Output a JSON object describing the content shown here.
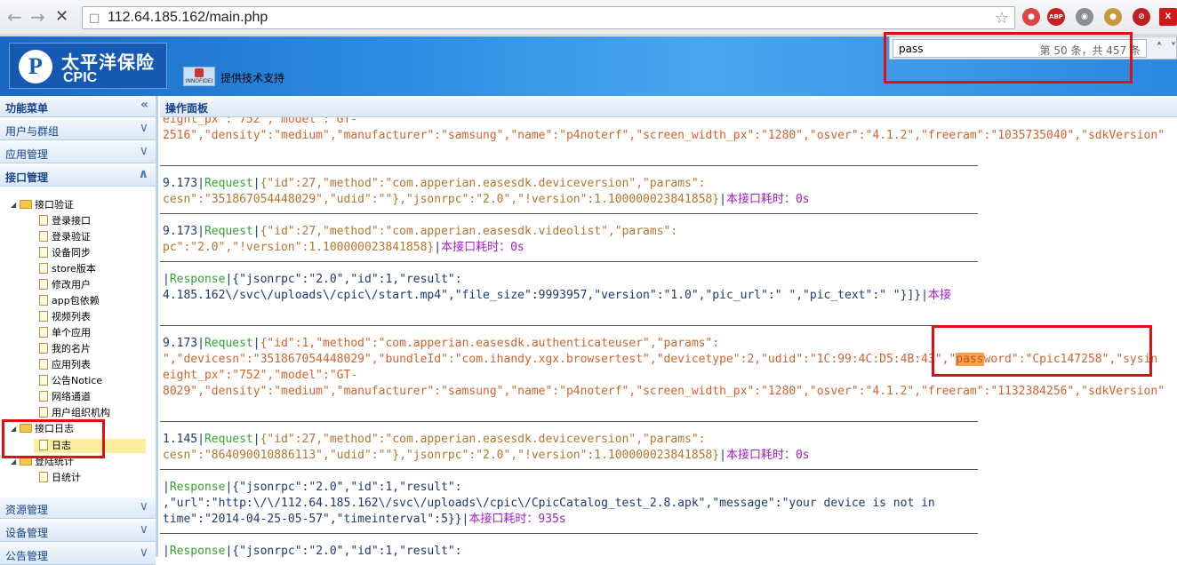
{
  "browser": {
    "url": "112.64.185.162/main.php",
    "stop_label": "✕",
    "ext_abp": "ABP"
  },
  "banner": {
    "logo_cn": "太平洋保险",
    "logo_en": "CPIC",
    "support_text": "提供技术支持",
    "support_brand": "INNOFIDEI"
  },
  "findbar": {
    "query": "pass",
    "count": "第 50 条，共 457 条"
  },
  "sidebar": {
    "header": "功能菜单",
    "sections": [
      "用户与群组",
      "应用管理",
      "接口管理"
    ],
    "bottom_sections": [
      "资源管理",
      "设备管理",
      "公告管理"
    ],
    "tree": {
      "folder1": "接口验证",
      "items": [
        "登录接口",
        "登录验证",
        "设备同步",
        "store版本",
        "修改用户",
        "app包依赖",
        "视频列表",
        "单个应用",
        "我的名片",
        "应用列表",
        "公告Notice",
        "网络通道",
        "用户组织机构"
      ],
      "folder2": "接口日志",
      "folder2_item": "日志",
      "folder3": "登陆统计",
      "folder3_item": "日统计"
    }
  },
  "panel": {
    "header": "操作面板"
  },
  "log": {
    "l0": "eight_px\":\"752\",\"model\":\"GT-",
    "l1": "2516\",\"density\":\"medium\",\"manufacturer\":\"samsung\",\"name\":\"p4noterf\",\"screen_width_px\":\"1280\",\"osver\":\"4.1.2\",\"freeram\":\"1035735040\",\"sdkVersion\"",
    "b1_ip": "9.173",
    "b1_req": "Request",
    "b1_a": "{\"id\":27,\"method\":\"com.apperian.easesdk.deviceversion\",\"params\":",
    "b1_b": "cesn\":\"351867054448029\",\"udid\":\"\"},\"jsonrpc\":\"2.0\",\"!version\":1.100000023841858}",
    "b1_time": "本接口耗时：0s",
    "b2_ip": "9.173",
    "b2_req": "Request",
    "b2_a": "{\"id\":27,\"method\":\"com.apperian.easesdk.videolist\",\"params\":",
    "b2_b": "pc\":\"2.0\",\"!version\":1.100000023841858}",
    "b2_time": "本接口耗时：0s",
    "b3_resp": "Response",
    "b3_a": "{\"jsonrpc\":\"2.0\",\"id\":1,\"result\":",
    "b3_b": "4.185.162\\/svc\\/uploads\\/cpic\\/start.mp4\",\"file_size\":9993957,\"version\":\"1.0\",\"pic_url\":\" \",\"pic_text\":\" \"}]}",
    "b3_time": "本接",
    "b4_ip": "9.173",
    "b4_req": "Request",
    "b4_a": "{\"id\":1,\"method\":\"com.apperian.easesdk.authenticateuser\",\"params\":",
    "b4_b1": "\",\"devicesn\":\"351867054448029\",\"bundleId\":\"com.ihandy.xgx.browsertest\",\"devicetype\":2,\"udid\":\"1C:99:4C:D5:4B:43\",\"",
    "b4_hl": "pass",
    "b4_b2": "word\":\"Cpic147258\",\"sysin",
    "b4_c": "eight_px\":\"752\",\"model\":\"GT-",
    "b4_d": "8029\",\"density\":\"medium\",\"manufacturer\":\"samsung\",\"name\":\"p4noterf\",\"screen_width_px\":\"1280\",\"osver\":\"4.1.2\",\"freeram\":\"1132384256\",\"sdkVersion\"",
    "b5_ip": "1.145",
    "b5_req": "Request",
    "b5_a": "{\"id\":27,\"method\":\"com.apperian.easesdk.deviceversion\",\"params\":",
    "b5_b": "cesn\":\"864090010886113\",\"udid\":\"\"},\"jsonrpc\":\"2.0\",\"!version\":1.100000023841858}",
    "b5_time": "本接口耗时：0s",
    "b6_resp": "Response",
    "b6_a": "{\"jsonrpc\":\"2.0\",\"id\":1,\"result\":",
    "b6_b": ",\"url\":\"http:\\/\\/112.64.185.162\\/svc\\/uploads\\/cpic\\/CpicCatalog_test_2.8.apk\",\"message\":\"your device is not in",
    "b6_c": "time\":\"2014-04-25-05-57\",\"timeinterval\":5}}",
    "b6_time": "本接口耗时：935s",
    "b7_resp": "Response",
    "b7_a": "{\"jsonrpc\":\"2.0\",\"id\":1,\"result\":"
  }
}
